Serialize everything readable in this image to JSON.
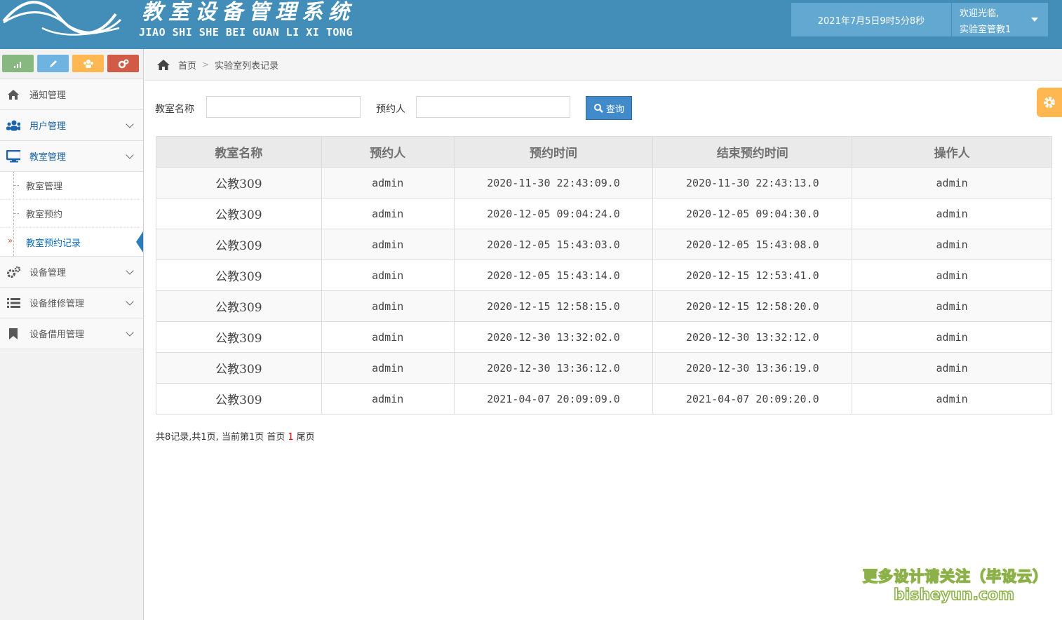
{
  "header": {
    "title_cn": "教室设备管理系统",
    "title_en": "JIAO SHI SHE BEI GUAN LI XI TONG",
    "datetime": "2021年7月5日9时5分8秒",
    "welcome": "欢迎光临,",
    "username": "实验室管教1"
  },
  "sidebar": {
    "shortcuts": [
      {
        "icon": "signal-icon",
        "color": "#87b87f"
      },
      {
        "icon": "pencil-icon",
        "color": "#6fb3e0"
      },
      {
        "icon": "group-icon",
        "color": "#ffb752"
      },
      {
        "icon": "cogs-icon",
        "color": "#d15b47"
      }
    ],
    "items": [
      {
        "label": "通知管理",
        "icon": "home-icon"
      },
      {
        "label": "用户管理",
        "icon": "users-icon"
      },
      {
        "label": "教室管理",
        "icon": "desktop-icon"
      },
      {
        "label": "设备管理",
        "icon": "cogs-icon"
      },
      {
        "label": "设备维修管理",
        "icon": "list-icon"
      },
      {
        "label": "设备借用管理",
        "icon": "bookmark-icon"
      }
    ],
    "sub_items": [
      {
        "label": "教室管理"
      },
      {
        "label": "教室预约"
      },
      {
        "label": "教室预约记录"
      }
    ],
    "active_marker": "»"
  },
  "breadcrumb": {
    "home": "首页",
    "current": "实验室列表记录"
  },
  "search": {
    "room_label": "教室名称",
    "room_value": "",
    "person_label": "预约人",
    "person_value": "",
    "button": "查询"
  },
  "table": {
    "headers": [
      "教室名称",
      "预约人",
      "预约时间",
      "结束预约时间",
      "操作人"
    ],
    "rows": [
      [
        "公教309",
        "admin",
        "2020-11-30 22:43:09.0",
        "2020-11-30 22:43:13.0",
        "admin"
      ],
      [
        "公教309",
        "admin",
        "2020-12-05 09:04:24.0",
        "2020-12-05 09:04:30.0",
        "admin"
      ],
      [
        "公教309",
        "admin",
        "2020-12-05 15:43:03.0",
        "2020-12-05 15:43:08.0",
        "admin"
      ],
      [
        "公教309",
        "admin",
        "2020-12-05 15:43:14.0",
        "2020-12-15 12:53:41.0",
        "admin"
      ],
      [
        "公教309",
        "admin",
        "2020-12-15 12:58:15.0",
        "2020-12-15 12:58:20.0",
        "admin"
      ],
      [
        "公教309",
        "admin",
        "2020-12-30 13:32:02.0",
        "2020-12-30 13:32:12.0",
        "admin"
      ],
      [
        "公教309",
        "admin",
        "2020-12-30 13:36:12.0",
        "2020-12-30 13:36:19.0",
        "admin"
      ],
      [
        "公教309",
        "admin",
        "2021-04-07 20:09:09.0",
        "2021-04-07 20:09:20.0",
        "admin"
      ]
    ]
  },
  "pager": {
    "summary": "共8记录,共1页, 当前第1页",
    "first": "首页",
    "current_page": "1",
    "last": "尾页"
  },
  "watermark": {
    "line1": "更多设计请关注（毕设云）",
    "line2": "bisheyun.com"
  },
  "colors": {
    "header_bg": "#438eb9",
    "accent_blue": "#428bca",
    "active_item": "#1963aa"
  }
}
